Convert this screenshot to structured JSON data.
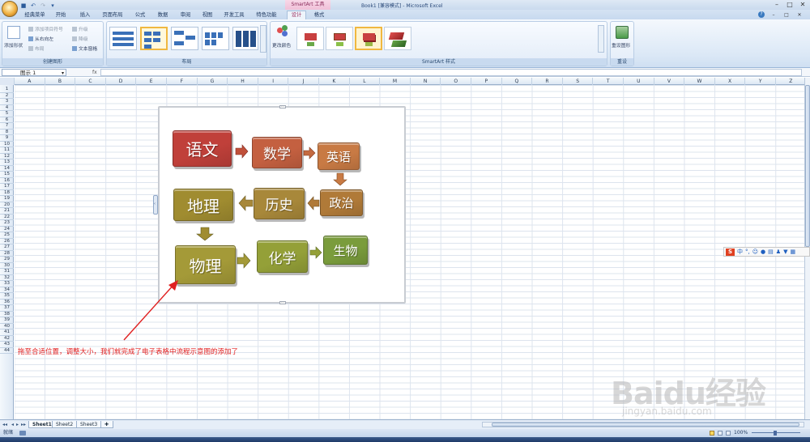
{
  "window": {
    "title": "Book1 [兼容模式] - Microsoft Excel",
    "context_tab_title": "SmartArt 工具"
  },
  "tabs": [
    {
      "label": "经典菜单"
    },
    {
      "label": "开始"
    },
    {
      "label": "插入"
    },
    {
      "label": "页面布局"
    },
    {
      "label": "公式"
    },
    {
      "label": "数据"
    },
    {
      "label": "审阅"
    },
    {
      "label": "视图"
    },
    {
      "label": "开发工具"
    },
    {
      "label": "特色功能"
    },
    {
      "label": "设计"
    },
    {
      "label": "格式"
    }
  ],
  "ribbon": {
    "create_graphic": {
      "label": "创建图形",
      "add_shape": "添加形状",
      "add_bullet": "添加项目符号",
      "right_to_left": "从右向左",
      "layout": "布局",
      "promote": "升级",
      "demote": "降级",
      "text_pane": "文本窗格"
    },
    "layouts": {
      "label": "布局"
    },
    "styles": {
      "label": "SmartArt 样式",
      "change_colors": "更改颜色"
    },
    "reset": {
      "label": "重设",
      "reset_graphic": "重设图形"
    }
  },
  "formula_bar": {
    "name_box": "图示 1",
    "fx": "fx"
  },
  "columns": [
    "A",
    "B",
    "C",
    "D",
    "E",
    "F",
    "G",
    "H",
    "I",
    "J",
    "K",
    "L",
    "M",
    "N",
    "O",
    "P",
    "Q",
    "R",
    "S",
    "T",
    "U",
    "V",
    "W",
    "X",
    "Y",
    "Z"
  ],
  "rows": [
    "1",
    "2",
    "3",
    "4",
    "5",
    "6",
    "7",
    "8",
    "9",
    "10",
    "11",
    "12",
    "13",
    "14",
    "15",
    "16",
    "17",
    "18",
    "19",
    "20",
    "21",
    "22",
    "23",
    "24",
    "25",
    "26",
    "27",
    "28",
    "29",
    "30",
    "31",
    "32",
    "33",
    "34",
    "35",
    "36",
    "37",
    "38",
    "39",
    "40",
    "41",
    "42",
    "43",
    "44"
  ],
  "smartart": {
    "nodes": [
      {
        "text": "语文",
        "color": "#c0403a"
      },
      {
        "text": "数学",
        "color": "#c46040"
      },
      {
        "text": "英语",
        "color": "#c87a44"
      },
      {
        "text": "政治",
        "color": "#b07a38"
      },
      {
        "text": "历史",
        "color": "#a8883a"
      },
      {
        "text": "地理",
        "color": "#a08c30"
      },
      {
        "text": "物理",
        "color": "#a49a38"
      },
      {
        "text": "化学",
        "color": "#94a038"
      },
      {
        "text": "生物",
        "color": "#7a9c3c"
      }
    ]
  },
  "annotation": "拖至合适位置，调整大小，我们就完成了电子表格中流程示意图的添加了",
  "sheets": [
    "Sheet1",
    "Sheet2",
    "Sheet3"
  ],
  "status": {
    "ready": "就绪",
    "zoom": "100%"
  },
  "ime": {
    "mode": "中"
  },
  "watermark": {
    "logo": "Baidu经验",
    "url": "jingyan.baidu.com"
  }
}
